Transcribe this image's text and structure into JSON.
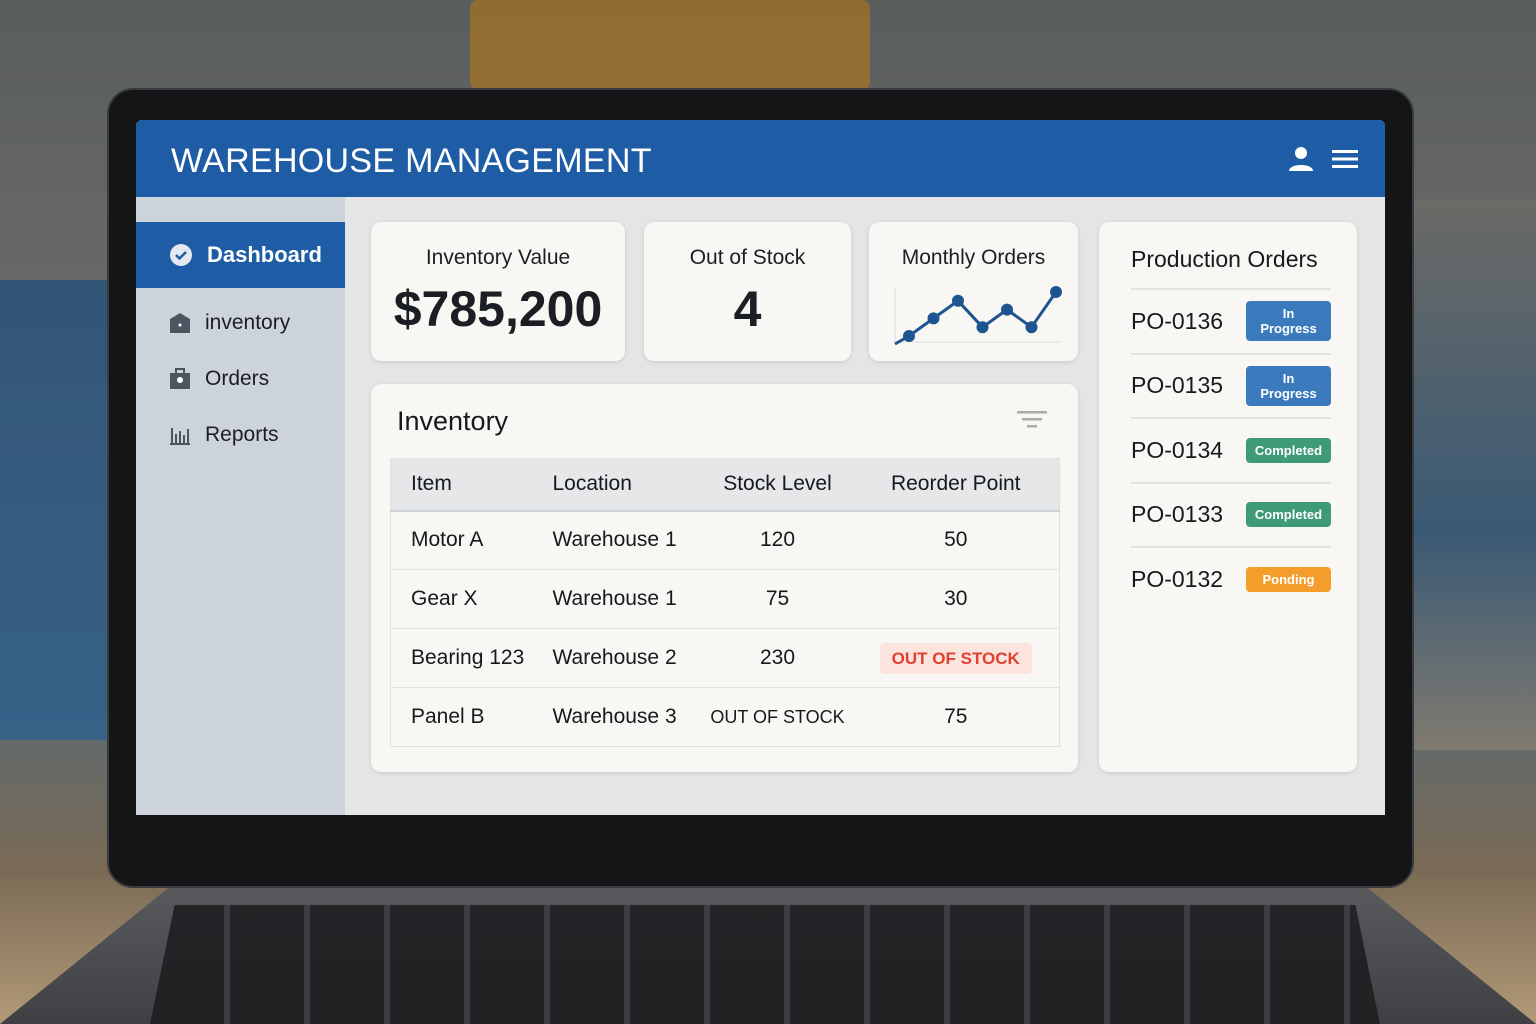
{
  "header": {
    "title": "WAREHOUSE MANAGEMENT",
    "user_icon": "user-icon",
    "menu_icon": "menu-icon"
  },
  "sidebar": {
    "items": [
      {
        "label": "Dashboard",
        "icon": "check-circle-icon",
        "active": true
      },
      {
        "label": "inventory",
        "icon": "warehouse-icon"
      },
      {
        "label": "Orders",
        "icon": "briefcase-icon"
      },
      {
        "label": "Reports",
        "icon": "bar-chart-icon"
      }
    ]
  },
  "kpis": {
    "inventory_value": {
      "label": "Inventory Value",
      "value": "$785,200"
    },
    "out_of_stock": {
      "label": "Out of Stock",
      "value": "4"
    },
    "monthly_orders": {
      "label": "Monthly Orders",
      "trend": [
        2,
        4,
        6,
        3,
        5,
        3,
        7
      ]
    }
  },
  "inventory": {
    "title": "Inventory",
    "columns": [
      "Item",
      "Location",
      "Stock Level",
      "Reorder Point"
    ],
    "rows": [
      [
        "Motor A",
        "Warehouse 1",
        "120",
        "50"
      ],
      [
        "Gear X",
        "Warehouse 1",
        "75",
        "30"
      ],
      [
        "Bearing 123",
        "Warehouse 2",
        "230",
        "OUT OF STOCK"
      ],
      [
        "Panel B",
        "Warehouse 3",
        "OUT OF STOCK",
        "75"
      ]
    ]
  },
  "production": {
    "title": "Production Orders",
    "orders": [
      {
        "id": "PO-0136",
        "status": "In Progress",
        "color": "#3b7bbd"
      },
      {
        "id": "PO-0135",
        "status": "In Progress",
        "color": "#3b7bbd"
      },
      {
        "id": "PO-0134",
        "status": "Completed",
        "color": "#3f9a78"
      },
      {
        "id": "PO-0133",
        "status": "Completed",
        "color": "#3f9a78"
      },
      {
        "id": "PO-0132",
        "status": "Ponding",
        "color": "#f59d2a"
      }
    ]
  }
}
